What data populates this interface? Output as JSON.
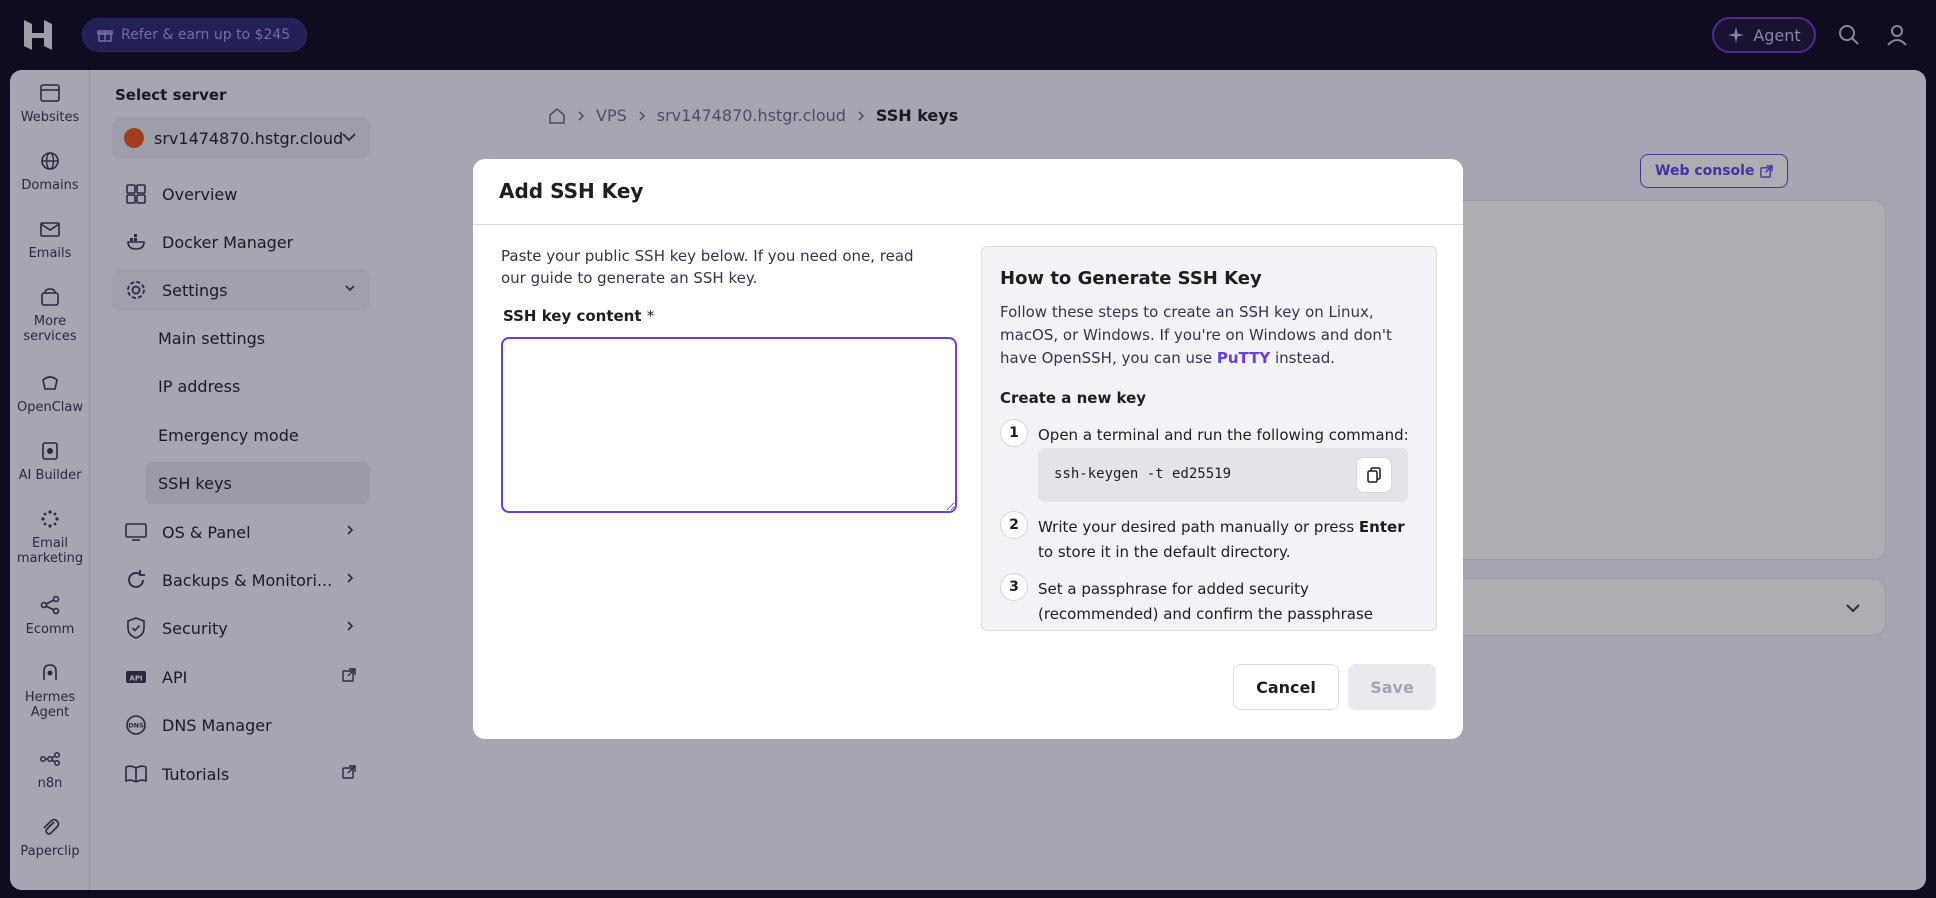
{
  "topbar": {
    "refer_label": "Refer & earn up to $245",
    "agent_label": "Agent"
  },
  "rail": [
    {
      "label": "Websites",
      "icon": "websites-icon"
    },
    {
      "label": "Domains",
      "icon": "globe-icon"
    },
    {
      "label": "Emails",
      "icon": "mail-icon"
    },
    {
      "label": "More services",
      "icon": "box-icon"
    },
    {
      "label": "OpenClaw",
      "icon": "claw-icon"
    },
    {
      "label": "AI Builder",
      "icon": "ai-builder-icon"
    },
    {
      "label": "Email marketing",
      "icon": "sparkle-icon"
    },
    {
      "label": "Ecomm",
      "icon": "share-icon"
    },
    {
      "label": "Hermes Agent",
      "icon": "hermes-icon"
    },
    {
      "label": "n8n",
      "icon": "n8n-icon"
    },
    {
      "label": "Paperclip",
      "icon": "paperclip-icon"
    }
  ],
  "sidebar": {
    "select_label": "Select server",
    "server_name": "srv1474870.hstgr.cloud",
    "items": [
      {
        "label": "Overview"
      },
      {
        "label": "Docker Manager"
      },
      {
        "label": "Settings"
      },
      {
        "label": "Main settings"
      },
      {
        "label": "IP address"
      },
      {
        "label": "Emergency mode"
      },
      {
        "label": "SSH keys"
      },
      {
        "label": "OS & Panel"
      },
      {
        "label": "Backups & Monitori..."
      },
      {
        "label": "Security"
      },
      {
        "label": "API"
      },
      {
        "label": "DNS Manager"
      },
      {
        "label": "Tutorials"
      }
    ]
  },
  "main": {
    "breadcrumb": [
      "VPS",
      "srv1474870.hstgr.cloud",
      "SSH keys"
    ],
    "web_console_label": "Web console"
  },
  "modal": {
    "title": "Add SSH Key",
    "intro": "Paste your public SSH key below. If you need one, read our guide to generate an SSH key.",
    "field_label": "SSH key content",
    "required_mark": "*",
    "textarea_value": "",
    "howto": {
      "title": "How to Generate SSH Key",
      "desc_before": "Follow these steps to create an SSH key on Linux, macOS, or Windows. If you're on Windows and don't have OpenSSH, you can use ",
      "desc_link": "PuTTY",
      "desc_after": " instead.",
      "subtitle": "Create a new key",
      "steps": [
        {
          "num": "1",
          "text": "Open a terminal and run the following command:"
        },
        {
          "num": "2",
          "text_before": "Write your desired path manually or press ",
          "text_bold": "Enter",
          "text_after": " to store it in the default directory."
        },
        {
          "num": "3",
          "text": "Set a passphrase for added security (recommended) and confirm the passphrase"
        }
      ],
      "command": "ssh-keygen -t ed25519"
    },
    "cancel_label": "Cancel",
    "save_label": "Save"
  },
  "colors": {
    "accent": "#673de6",
    "topbar_bg": "#0b0a1f"
  }
}
